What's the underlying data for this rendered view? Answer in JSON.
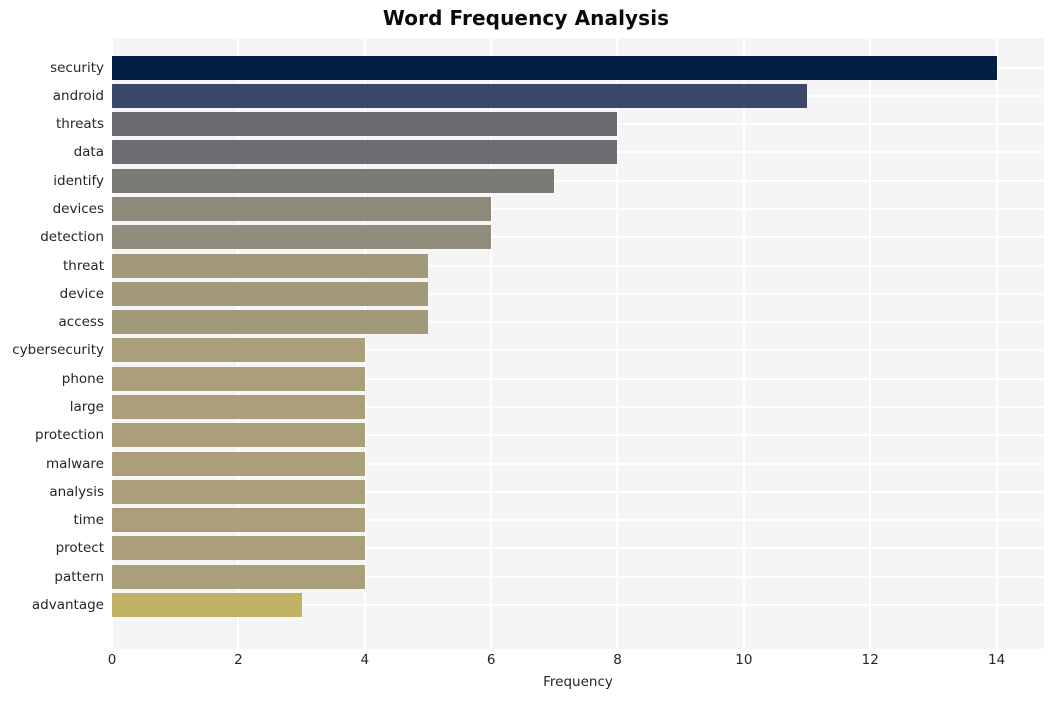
{
  "chart_data": {
    "type": "bar",
    "orientation": "horizontal",
    "title": "Word Frequency Analysis",
    "xlabel": "Frequency",
    "ylabel": "",
    "categories": [
      "security",
      "android",
      "threats",
      "data",
      "identify",
      "devices",
      "detection",
      "threat",
      "device",
      "access",
      "cybersecurity",
      "phone",
      "large",
      "protection",
      "malware",
      "analysis",
      "time",
      "protect",
      "pattern",
      "advantage"
    ],
    "values": [
      14,
      11,
      8,
      8,
      7,
      6,
      6,
      5,
      5,
      5,
      4,
      4,
      4,
      4,
      4,
      4,
      4,
      4,
      4,
      3
    ],
    "bar_colors": [
      "#032044",
      "#3c4869",
      "#6a6b71",
      "#6c6d72",
      "#7c7a76",
      "#8e8a7a",
      "#918c7c",
      "#a2997a",
      "#a2997a",
      "#a2997a",
      "#ab9f79",
      "#ab9f79",
      "#ab9f79",
      "#ab9f79",
      "#ab9f79",
      "#ab9f79",
      "#ab9f79",
      "#ab9f79",
      "#ab9f79",
      "#c0b265"
    ],
    "xticks": [
      0,
      2,
      4,
      6,
      8,
      10,
      12,
      14
    ],
    "xtick_labels": [
      "0",
      "2",
      "4",
      "6",
      "8",
      "10",
      "12",
      "14"
    ],
    "xlim": [
      0,
      14.75
    ],
    "grid": true,
    "grid_color": "#ffffff",
    "plot_background": "#f5f5f6",
    "figure_background": "#ffffff",
    "legend": "none"
  }
}
